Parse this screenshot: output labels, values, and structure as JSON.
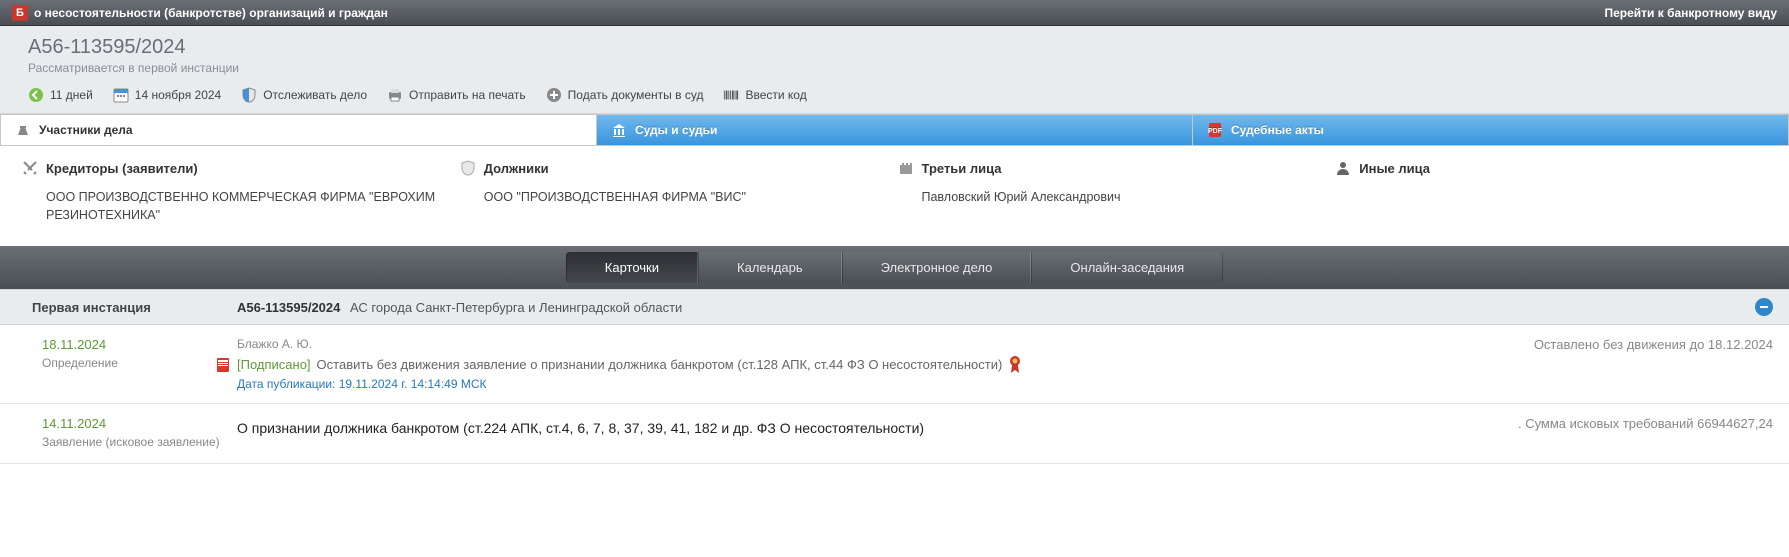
{
  "topbar": {
    "badge": "Б",
    "title": "о несостоятельности (банкротстве) организаций и граждан",
    "right_link": "Перейти к банкротному виду"
  },
  "case": {
    "number": "А56-113595/2024",
    "status": "Рассматривается в первой инстанции",
    "actions": {
      "days": "11 дней",
      "date": "14 ноября 2024",
      "track": "Отслеживать дело",
      "print": "Отправить на печать",
      "file": "Подать документы в суд",
      "code": "Ввести код"
    }
  },
  "tabs": {
    "participants": "Участники дела",
    "courts": "Суды и судьи",
    "acts": "Судебные акты"
  },
  "participants": {
    "creditors": {
      "label": "Кредиторы (заявители)",
      "item": "ООО ПРОИЗВОДСТВЕННО КОММЕРЧЕСКАЯ ФИРМА \"ЕВРОХИМ РЕЗИНОТЕХНИКА\""
    },
    "debtors": {
      "label": "Должники",
      "item": "ООО \"ПРОИЗВОДСТВЕННАЯ ФИРМА \"ВИС\""
    },
    "third": {
      "label": "Третьи лица",
      "item": "Павловский Юрий Александрович"
    },
    "other": {
      "label": "Иные лица",
      "item": ""
    }
  },
  "midtabs": {
    "cards": "Карточки",
    "calendar": "Календарь",
    "efile": "Электронное дело",
    "online": "Онлайн-заседания"
  },
  "instance": {
    "label": "Первая инстанция",
    "case_no": "А56-113595/2024",
    "court": "АС города Санкт-Петербурга и Ленинградской области"
  },
  "entries": [
    {
      "date": "18.11.2024",
      "type": "Определение",
      "author": "Блажко А. Ю.",
      "signed": "[Подписано]",
      "title": "Оставить без движения заявление о признании должника банкротом (ст.128 АПК, ст.44 ФЗ О несостоятельности)",
      "pub": "Дата публикации: 19.11.2024 г. 14:14:49 МСК",
      "right": "Оставлено без движения до 18.12.2024"
    },
    {
      "date": "14.11.2024",
      "type": "Заявление (исковое заявление)",
      "title": "О признании должника банкротом (ст.224 АПК, ст.4, 6, 7, 8, 37, 39, 41, 182 и др. ФЗ О несостоятельности)",
      "right": ". Сумма исковых требований 66944627,24"
    }
  ]
}
